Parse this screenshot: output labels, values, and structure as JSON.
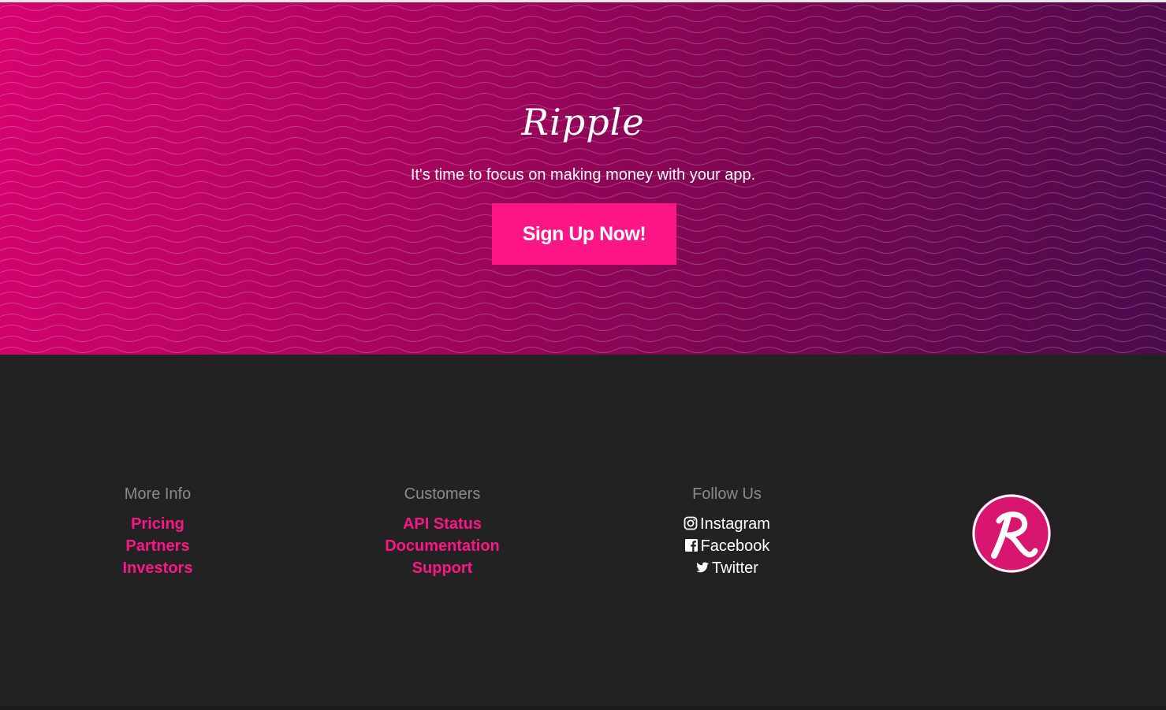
{
  "hero": {
    "brand": "Ripple",
    "tagline": "It's time to focus on making money with your app.",
    "signup_label": "Sign Up Now!"
  },
  "footer": {
    "more_info": {
      "heading": "More Info",
      "links": [
        "Pricing",
        "Partners",
        "Investors"
      ]
    },
    "customers": {
      "heading": "Customers",
      "links": [
        "API Status",
        "Documentation",
        "Support"
      ]
    },
    "follow_us": {
      "heading": "Follow Us",
      "links": [
        {
          "label": "Instagram",
          "icon": "instagram-icon"
        },
        {
          "label": "Facebook",
          "icon": "facebook-icon"
        },
        {
          "label": "Twitter",
          "icon": "twitter-icon"
        }
      ]
    },
    "badge_letter": "R"
  },
  "colors": {
    "accent": "#ff1686",
    "footer_bg": "#222222",
    "heading_gray": "#8a8a8a"
  }
}
